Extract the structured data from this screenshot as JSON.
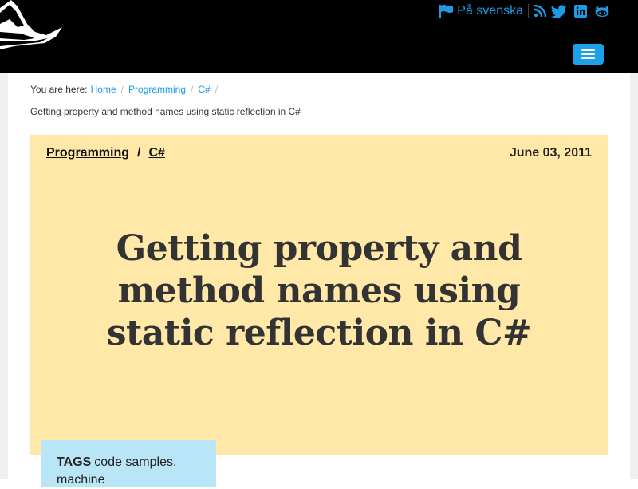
{
  "header": {
    "language_link": "På svenska",
    "social_icons": [
      "rss-icon",
      "twitter-icon",
      "linkedin-icon",
      "github-icon"
    ],
    "accent_color": "#1d9be6",
    "menu_button_color": "#1ba1e8"
  },
  "breadcrumb": {
    "prefix": "You are here:",
    "items": [
      "Home",
      "Programming",
      "C#"
    ],
    "current": "Getting property and method names using static reflection in C#"
  },
  "article": {
    "categories": [
      "Programming",
      "C#"
    ],
    "category_separator": "/",
    "date": "June 03, 2011",
    "title": "Getting property and method names using static reflection in C#",
    "hero_color": "#ffe8a8"
  },
  "tags": {
    "label": "TAGS",
    "value": "code samples, machine"
  }
}
